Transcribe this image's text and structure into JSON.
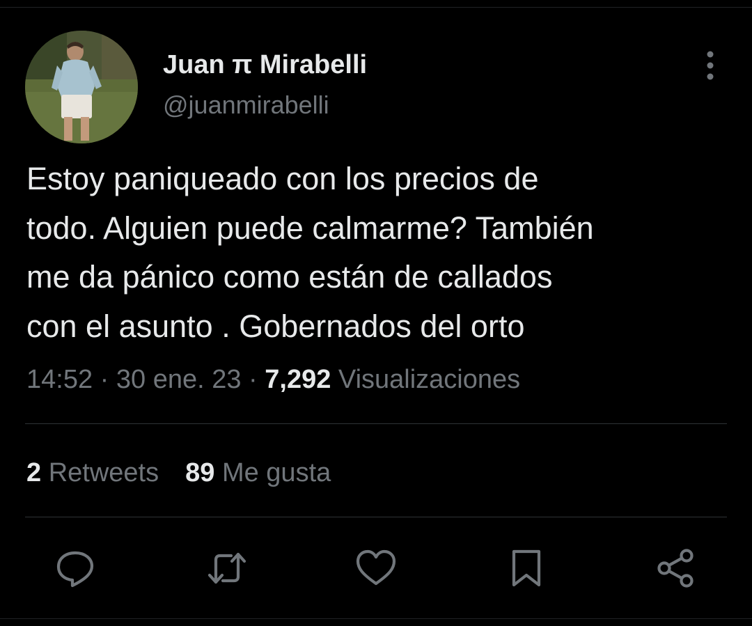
{
  "tweet": {
    "author": {
      "display_name": "Juan π Mirabelli",
      "handle": "@juanmirabelli"
    },
    "text_lines": [
      "Estoy paniqueado con los precios de",
      "todo. Alguien puede calmarme? También",
      "me da pánico como están de callados",
      "con el asunto . Gobernados del orto"
    ],
    "time": "14:52",
    "separator": "·",
    "date": "30 ene. 23",
    "views_count": "7,292",
    "views_label": "Visualizaciones",
    "retweets_count": "2",
    "retweets_label": "Retweets",
    "likes_count": "89",
    "likes_label": "Me gusta"
  },
  "actions": {
    "reply": "reply-icon",
    "retweet": "retweet-icon",
    "like": "heart-icon",
    "bookmark": "bookmark-icon",
    "share": "share-icon",
    "more": "more-vertical-icon"
  },
  "colors": {
    "background": "#000000",
    "primary_text": "#e7e9ea",
    "secondary_text": "#71767b",
    "divider": "#2f3336"
  }
}
